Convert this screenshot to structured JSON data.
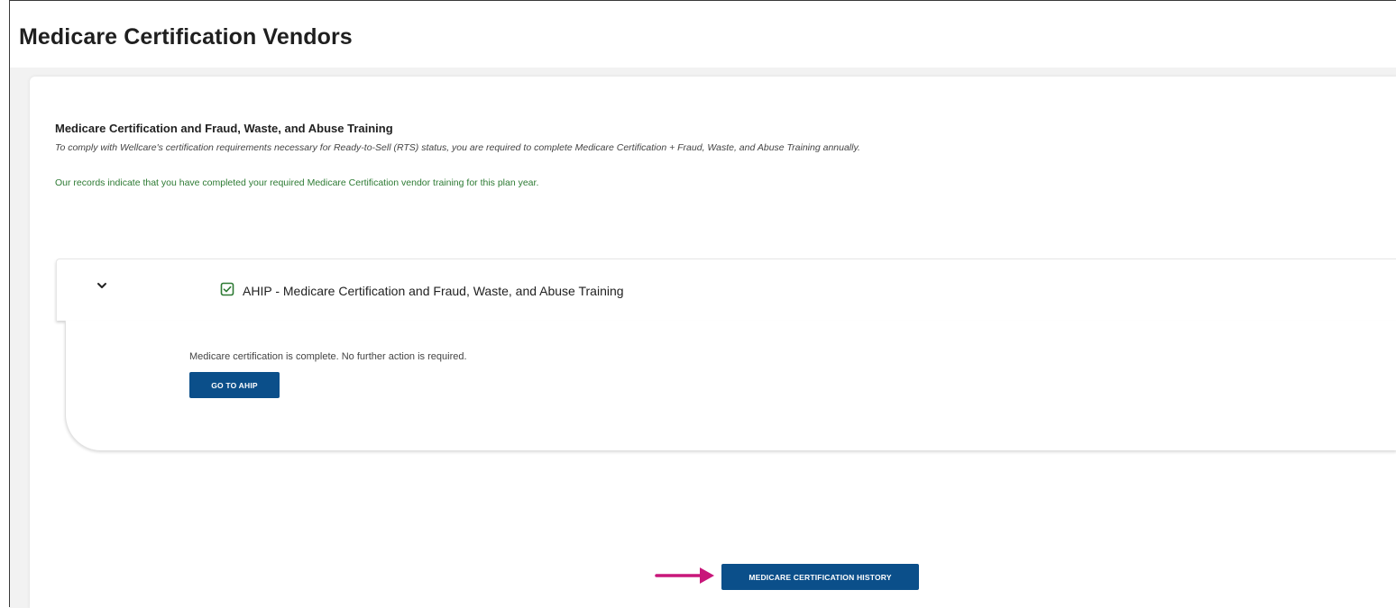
{
  "page": {
    "title": "Medicare Certification Vendors"
  },
  "section": {
    "title": "Medicare Certification and Fraud, Waste, and Abuse Training",
    "description": "To comply with Wellcare's certification requirements necessary for Ready-to-Sell (RTS) status, you are required to complete Medicare Certification + Fraud, Waste, and Abuse Training annually.",
    "status_message": "Our records indicate that you have completed your required Medicare Certification vendor training for this plan year."
  },
  "vendor": {
    "title": "AHIP - Medicare Certification and Fraud, Waste, and Abuse Training",
    "complete_message": "Medicare certification is complete. No further action is required.",
    "go_button": "GO TO AHIP"
  },
  "footer": {
    "history_button": "MEDICARE CERTIFICATION HISTORY"
  },
  "colors": {
    "primary_button": "#0b4f8a",
    "success_text": "#2d7a33",
    "arrow": "#c8177a"
  },
  "icons": {
    "expand": "chevron-down-icon",
    "status": "checkbox-checked-icon",
    "pointer": "arrow-right-icon"
  }
}
